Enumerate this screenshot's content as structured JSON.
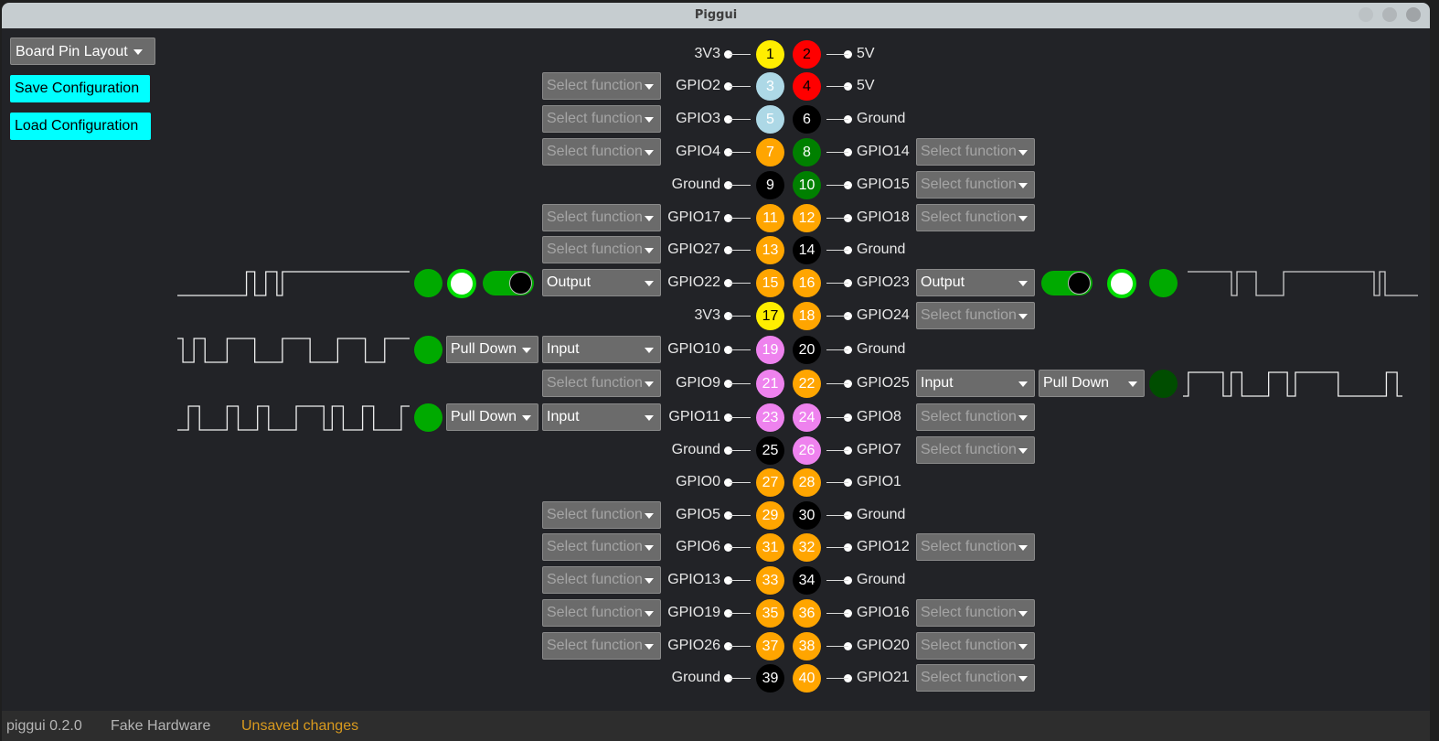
{
  "window": {
    "title": "Piggui"
  },
  "sidebar": {
    "layout_select": "Board Pin Layout",
    "save_label": "Save Configuration",
    "load_label": "Load Configuration"
  },
  "colors": {
    "power3v3": "#ffee00",
    "power5v": "#ff0000",
    "i2c": "#add8e6",
    "ground": "#000000",
    "uart": "#008000",
    "gpio": "#ffa500",
    "spi": "#ee82ee",
    "accent_button": "#00ffff",
    "led_on": "#00aa00",
    "led_off": "#004d00",
    "unsaved": "#d99a1e"
  },
  "placeholder": "Select function",
  "pins": [
    {
      "num": "1",
      "name": "3V3",
      "color": "#ffee00",
      "text": "#000000",
      "select": null
    },
    {
      "num": "2",
      "name": "5V",
      "color": "#ff0000",
      "text": "#000000",
      "select": null
    },
    {
      "num": "3",
      "name": "GPIO2",
      "color": "#add8e6",
      "text": "#ffffff",
      "select": "Select function"
    },
    {
      "num": "4",
      "name": "5V",
      "color": "#ff0000",
      "text": "#000000",
      "select": null
    },
    {
      "num": "5",
      "name": "GPIO3",
      "color": "#add8e6",
      "text": "#ffffff",
      "select": "Select function"
    },
    {
      "num": "6",
      "name": "Ground",
      "color": "#000000",
      "text": "#ffffff",
      "select": null
    },
    {
      "num": "7",
      "name": "GPIO4",
      "color": "#ffa500",
      "text": "#ffffff",
      "select": "Select function"
    },
    {
      "num": "8",
      "name": "GPIO14",
      "color": "#008000",
      "text": "#ffffff",
      "select": "Select function"
    },
    {
      "num": "9",
      "name": "Ground",
      "color": "#000000",
      "text": "#ffffff",
      "select": null
    },
    {
      "num": "10",
      "name": "GPIO15",
      "color": "#008000",
      "text": "#ffffff",
      "select": "Select function"
    },
    {
      "num": "11",
      "name": "GPIO17",
      "color": "#ffa500",
      "text": "#ffffff",
      "select": "Select function"
    },
    {
      "num": "12",
      "name": "GPIO18",
      "color": "#ffa500",
      "text": "#ffffff",
      "select": "Select function"
    },
    {
      "num": "13",
      "name": "GPIO27",
      "color": "#ffa500",
      "text": "#ffffff",
      "select": "Select function"
    },
    {
      "num": "14",
      "name": "Ground",
      "color": "#000000",
      "text": "#ffffff",
      "select": null
    },
    {
      "num": "15",
      "name": "GPIO22",
      "color": "#ffa500",
      "text": "#ffffff",
      "select": "Output",
      "mode": "output",
      "level": 1
    },
    {
      "num": "16",
      "name": "GPIO23",
      "color": "#ffa500",
      "text": "#ffffff",
      "select": "Output",
      "mode": "output",
      "level": 1
    },
    {
      "num": "17",
      "name": "3V3",
      "color": "#ffee00",
      "text": "#000000",
      "select": null
    },
    {
      "num": "18",
      "name": "GPIO24",
      "color": "#ffa500",
      "text": "#ffffff",
      "select": "Select function"
    },
    {
      "num": "19",
      "name": "GPIO10",
      "color": "#ee82ee",
      "text": "#ffffff",
      "select": "Input",
      "mode": "input",
      "pull": "Pull Down",
      "level": 1
    },
    {
      "num": "20",
      "name": "Ground",
      "color": "#000000",
      "text": "#ffffff",
      "select": null
    },
    {
      "num": "21",
      "name": "GPIO9",
      "color": "#ee82ee",
      "text": "#ffffff",
      "select": "Select function"
    },
    {
      "num": "22",
      "name": "GPIO25",
      "color": "#ffa500",
      "text": "#ffffff",
      "select": "Input",
      "mode": "input",
      "pull": "Pull Down",
      "level": 0
    },
    {
      "num": "23",
      "name": "GPIO11",
      "color": "#ee82ee",
      "text": "#ffffff",
      "select": "Input",
      "mode": "input",
      "pull": "Pull Down",
      "level": 1
    },
    {
      "num": "24",
      "name": "GPIO8",
      "color": "#ee82ee",
      "text": "#ffffff",
      "select": "Select function"
    },
    {
      "num": "25",
      "name": "Ground",
      "color": "#000000",
      "text": "#ffffff",
      "select": null
    },
    {
      "num": "26",
      "name": "GPIO7",
      "color": "#ee82ee",
      "text": "#ffffff",
      "select": "Select function"
    },
    {
      "num": "27",
      "name": "GPIO0",
      "color": "#ffa500",
      "text": "#ffffff",
      "select": null
    },
    {
      "num": "28",
      "name": "GPIO1",
      "color": "#ffa500",
      "text": "#ffffff",
      "select": null
    },
    {
      "num": "29",
      "name": "GPIO5",
      "color": "#ffa500",
      "text": "#ffffff",
      "select": "Select function"
    },
    {
      "num": "30",
      "name": "Ground",
      "color": "#000000",
      "text": "#ffffff",
      "select": null
    },
    {
      "num": "31",
      "name": "GPIO6",
      "color": "#ffa500",
      "text": "#ffffff",
      "select": "Select function"
    },
    {
      "num": "32",
      "name": "GPIO12",
      "color": "#ffa500",
      "text": "#ffffff",
      "select": "Select function"
    },
    {
      "num": "33",
      "name": "GPIO13",
      "color": "#ffa500",
      "text": "#ffffff",
      "select": "Select function"
    },
    {
      "num": "34",
      "name": "Ground",
      "color": "#000000",
      "text": "#ffffff",
      "select": null
    },
    {
      "num": "35",
      "name": "GPIO19",
      "color": "#ffa500",
      "text": "#ffffff",
      "select": "Select function"
    },
    {
      "num": "36",
      "name": "GPIO16",
      "color": "#ffa500",
      "text": "#ffffff",
      "select": "Select function"
    },
    {
      "num": "37",
      "name": "GPIO26",
      "color": "#ffa500",
      "text": "#ffffff",
      "select": "Select function"
    },
    {
      "num": "38",
      "name": "GPIO20",
      "color": "#ffa500",
      "text": "#ffffff",
      "select": "Select function"
    },
    {
      "num": "39",
      "name": "Ground",
      "color": "#000000",
      "text": "#ffffff",
      "select": null
    },
    {
      "num": "40",
      "name": "GPIO21",
      "color": "#ffa500",
      "text": "#ffffff",
      "select": "Select function"
    }
  ],
  "waveforms": {
    "15": [
      0,
      0,
      0,
      0,
      0,
      0,
      0,
      0,
      0,
      0,
      0,
      0,
      0,
      0,
      0,
      0,
      0,
      0,
      0,
      0,
      0,
      0,
      0,
      0,
      0,
      1,
      1,
      1,
      0,
      0,
      0,
      0,
      1,
      1,
      1,
      1,
      0,
      0,
      1,
      1,
      1,
      1,
      1,
      1,
      1,
      1,
      1,
      1,
      1,
      1,
      1,
      1,
      1,
      1,
      1,
      1,
      1,
      1,
      1,
      1,
      1,
      1,
      1,
      1,
      1,
      1,
      1,
      1,
      1,
      1,
      1,
      1,
      1,
      1,
      1,
      1,
      1,
      1,
      1,
      1,
      1,
      1,
      1,
      1
    ],
    "16": [
      1,
      1,
      1,
      1,
      1,
      1,
      1,
      1,
      1,
      1,
      1,
      1,
      1,
      1,
      1,
      1,
      0,
      0,
      1,
      1,
      1,
      1,
      1,
      1,
      1,
      0,
      0,
      0,
      0,
      0,
      0,
      0,
      0,
      0,
      0,
      1,
      1,
      1,
      1,
      1,
      1,
      1,
      1,
      1,
      1,
      1,
      1,
      1,
      1,
      1,
      1,
      1,
      1,
      1,
      1,
      1,
      1,
      1,
      1,
      1,
      1,
      1,
      1,
      1,
      1,
      1,
      1,
      1,
      0,
      0,
      1,
      1,
      0,
      0,
      0,
      0,
      0,
      0,
      0,
      0,
      0,
      0,
      0,
      0
    ],
    "19": [
      1,
      1,
      0,
      0,
      0,
      0,
      1,
      1,
      1,
      1,
      0,
      0,
      0,
      0,
      0,
      0,
      0,
      0,
      1,
      1,
      1,
      1,
      1,
      1,
      1,
      1,
      1,
      1,
      0,
      0,
      0,
      0,
      0,
      0,
      0,
      0,
      0,
      0,
      1,
      1,
      1,
      1,
      1,
      1,
      1,
      1,
      1,
      1,
      0,
      0,
      0,
      0,
      0,
      0,
      0,
      0,
      0,
      0,
      1,
      1,
      1,
      1,
      1,
      1,
      1,
      1,
      1,
      1,
      0,
      0,
      0,
      0,
      0,
      0,
      0,
      1,
      1,
      1,
      1,
      1,
      1,
      1,
      1,
      1
    ],
    "22": [
      0,
      0,
      1,
      1,
      1,
      1,
      1,
      1,
      1,
      1,
      1,
      1,
      1,
      1,
      1,
      0,
      0,
      0,
      1,
      1,
      1,
      1,
      0,
      0,
      0,
      0,
      0,
      0,
      0,
      0,
      0,
      0,
      1,
      1,
      1,
      1,
      1,
      1,
      1,
      0,
      0,
      0,
      1,
      1,
      1,
      1,
      1,
      1,
      1,
      1,
      1,
      1,
      1,
      1,
      1,
      1,
      1,
      1,
      0,
      0,
      0,
      0,
      0,
      0,
      0,
      0,
      0,
      0,
      0,
      0,
      0,
      0,
      0,
      0,
      0,
      0,
      1,
      1,
      1,
      1,
      0,
      0
    ],
    "23": [
      0,
      0,
      0,
      0,
      1,
      1,
      1,
      1,
      0,
      0,
      0,
      0,
      0,
      0,
      0,
      0,
      0,
      0,
      1,
      1,
      1,
      1,
      0,
      0,
      0,
      0,
      0,
      0,
      0,
      1,
      1,
      1,
      1,
      0,
      0,
      0,
      0,
      0,
      0,
      0,
      0,
      0,
      0,
      1,
      1,
      1,
      1,
      1,
      1,
      1,
      1,
      1,
      1,
      0,
      0,
      0,
      1,
      1,
      1,
      1,
      0,
      0,
      0,
      0,
      0,
      0,
      0,
      1,
      1,
      1,
      1,
      0,
      0,
      0,
      0,
      0,
      0,
      0,
      0,
      0,
      0,
      1,
      1,
      1
    ]
  },
  "statusbar": {
    "version": "piggui 0.2.0",
    "hardware": "Fake Hardware",
    "unsaved": "Unsaved changes"
  }
}
